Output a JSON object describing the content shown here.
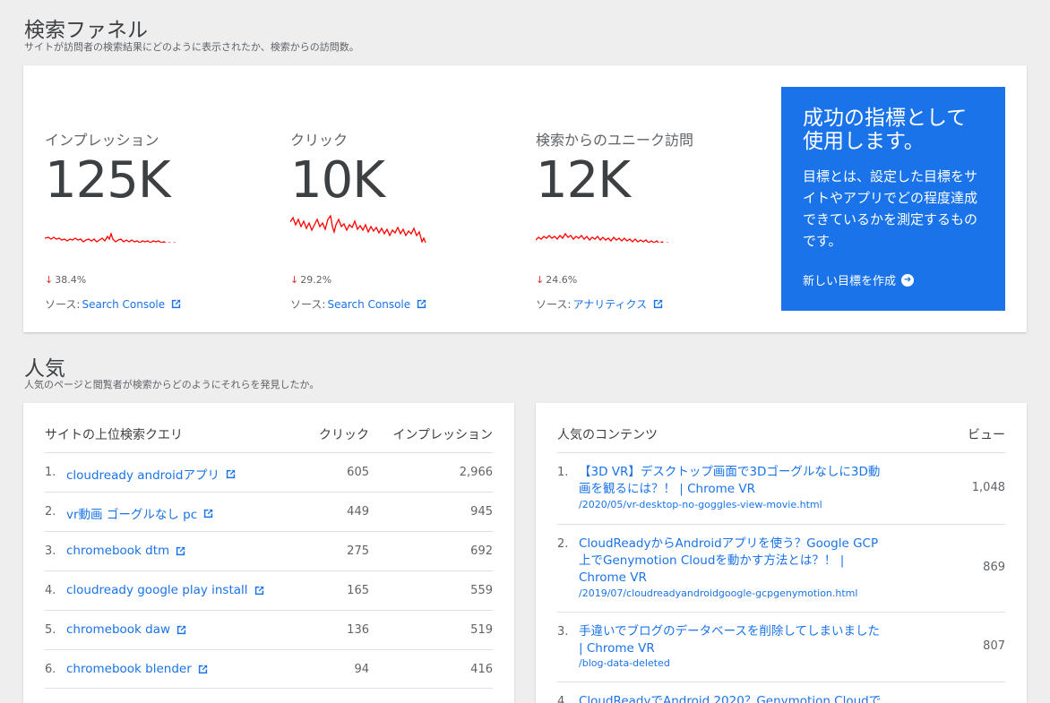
{
  "funnel": {
    "title": "検索ファネル",
    "subtitle": "サイトが訪問者の検索結果にどのように表示されたか、検索からの訪問数。",
    "source_prefix": "ソース: ",
    "metrics": [
      {
        "label": "インプレッション",
        "value": "125K",
        "change": "38.4%",
        "source": "Search Console"
      },
      {
        "label": "クリック",
        "value": "10K",
        "change": "29.2%",
        "source": "Search Console"
      },
      {
        "label": "検索からのユニーク訪問",
        "value": "12K",
        "change": "24.6%",
        "source": "アナリティクス"
      }
    ],
    "trend_color": "#ff0000"
  },
  "promo": {
    "title": "成功の指標として使用します。",
    "body": "目標とは、設定した目標をサイトやアプリでどの程度達成できているかを測定するものです。",
    "link": "新しい目標を作成",
    "bg_color": "#1a73e8"
  },
  "popular": {
    "title": "人気",
    "subtitle": "人気のページと閲覧者が検索からどのようにそれらを発見したか。"
  },
  "queries": {
    "header": {
      "query": "サイトの上位検索クエリ",
      "clicks": "クリック",
      "impressions": "インプレッション"
    },
    "rows": [
      {
        "n": "1.",
        "q": "cloudready androidアプリ",
        "clicks": "605",
        "imp": "2,966"
      },
      {
        "n": "2.",
        "q": "vr動画 ゴーグルなし pc",
        "clicks": "449",
        "imp": "945"
      },
      {
        "n": "3.",
        "q": "chromebook dtm",
        "clicks": "275",
        "imp": "692"
      },
      {
        "n": "4.",
        "q": "cloudready google play install",
        "clicks": "165",
        "imp": "559"
      },
      {
        "n": "5.",
        "q": "chromebook daw",
        "clicks": "136",
        "imp": "519"
      },
      {
        "n": "6.",
        "q": "chromebook blender",
        "clicks": "94",
        "imp": "416"
      }
    ]
  },
  "content": {
    "header": {
      "title": "人気のコンテンツ",
      "views": "ビュー"
    },
    "rows": [
      {
        "n": "1.",
        "title": "【3D VR】デスクトップ画面で3Dゴーグルなしに3D動画を観るには？！ | Chrome VR",
        "path": "/2020/05/vr-desktop-no-goggles-view-movie.html",
        "views": "1,048"
      },
      {
        "n": "2.",
        "title": "CloudReadyからAndroidアプリを使う？Google GCP上でGenymotion Cloudを動かす方法とは？！ | Chrome VR",
        "path": "/2019/07/cloudreadyandroidgoogle-gcpgenymotion.html",
        "views": "869"
      },
      {
        "n": "3.",
        "title": "手違いでブログのデータベースを削除してしまいました | Chrome VR",
        "path": "/blog-data-deleted",
        "views": "807"
      },
      {
        "n": "4.",
        "title": "CloudReadyでAndroid 2020？Genymotion Cloudで",
        "path": "",
        "views": ""
      }
    ]
  }
}
